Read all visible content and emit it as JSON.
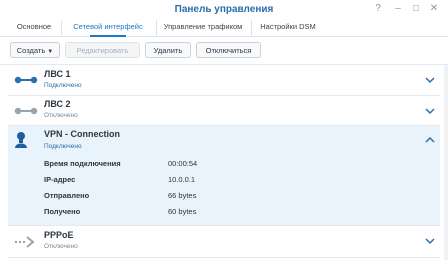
{
  "window": {
    "title": "Панель управления"
  },
  "tabs": [
    {
      "label": "Основное"
    },
    {
      "label": "Сетевой интерфейс",
      "active": true
    },
    {
      "label": "Управление трафиком"
    },
    {
      "label": "Настройки DSM"
    }
  ],
  "toolbar": {
    "create_label": "Создать",
    "edit_label": "Редактировать",
    "delete_label": "Удалить",
    "disconnect_label": "Отключиться"
  },
  "interfaces": [
    {
      "name": "ЛВС 1",
      "status": "Подключено",
      "icon": "lan-connected-icon",
      "state": "connected"
    },
    {
      "name": "ЛВС 2",
      "status": "Отключено",
      "icon": "lan-disconnected-icon",
      "state": "disconnected"
    },
    {
      "name": "VPN - Connection",
      "status": "Подключено",
      "icon": "vpn-user-icon",
      "state": "connected",
      "expanded": true,
      "details": [
        {
          "key": "Время подключения",
          "value": "00:00:54"
        },
        {
          "key": "IP-адрес",
          "value": "10.0.0.1"
        },
        {
          "key": "Отправлено",
          "value": "66 bytes"
        },
        {
          "key": "Получено",
          "value": "60 bytes"
        }
      ]
    },
    {
      "name": "PPPoE",
      "status": "Отключено",
      "icon": "pppoe-arrow-icon",
      "state": "disconnected"
    }
  ],
  "colors": {
    "accent": "#2a6eb0",
    "selected_row": "#e8f3fb"
  }
}
